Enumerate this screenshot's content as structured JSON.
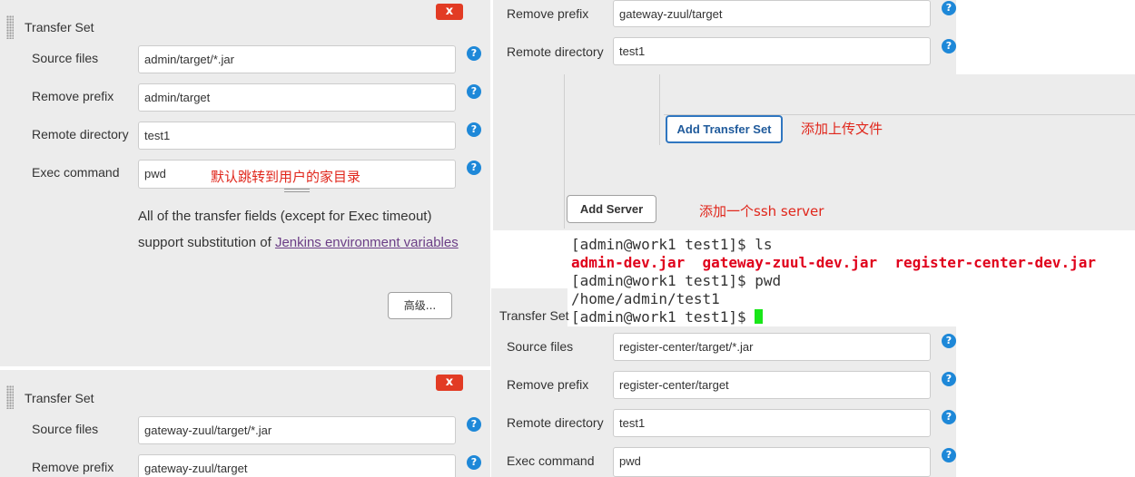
{
  "left_set1": {
    "title": "Transfer Set",
    "close": "x",
    "source_label": "Source files",
    "source_value": "admin/target/*.jar",
    "prefix_label": "Remove prefix",
    "prefix_value": "admin/target",
    "remote_label": "Remote directory",
    "remote_value": "test1",
    "exec_label": "Exec command",
    "exec_value": "pwd",
    "exec_note": "默认跳转到用户的家目录",
    "desc_text": "All of the transfer fields (except for Exec timeout) support substitution of",
    "desc_link": "Jenkins environment variables",
    "advanced_button": "高级..."
  },
  "left_set2": {
    "title": "Transfer Set",
    "close": "x",
    "source_label": "Source files",
    "source_value": "gateway-zuul/target/*.jar",
    "prefix_label": "Remove prefix",
    "prefix_value": "gateway-zuul/target"
  },
  "right_top": {
    "prefix_label": "Remove prefix",
    "prefix_value": "gateway-zuul/target",
    "remote_label": "Remote directory",
    "remote_value": "test1"
  },
  "actions": {
    "add_transfer_set": "Add Transfer Set",
    "add_transfer_note": "添加上传文件",
    "add_server": "Add Server",
    "add_server_note": "添加一个ssh server"
  },
  "terminal": {
    "line1": "[admin@work1 test1]$ ls",
    "files": "admin-dev.jar  gateway-zuul-dev.jar  register-center-dev.jar",
    "line3": "[admin@work1 test1]$ pwd",
    "line4": "/home/admin/test1",
    "line5": "[admin@work1 test1]$ "
  },
  "right_set": {
    "title": "Transfer Set",
    "source_label": "Source files",
    "source_value": "register-center/target/*.jar",
    "prefix_label": "Remove prefix",
    "prefix_value": "register-center/target",
    "remote_label": "Remote directory",
    "remote_value": "test1",
    "exec_label": "Exec command",
    "exec_value": "pwd"
  },
  "help_glyph": "?",
  "colors": {
    "accent": "#1e88d8",
    "danger": "#e23b24",
    "note": "#e0261b",
    "cursor": "#19e619"
  }
}
